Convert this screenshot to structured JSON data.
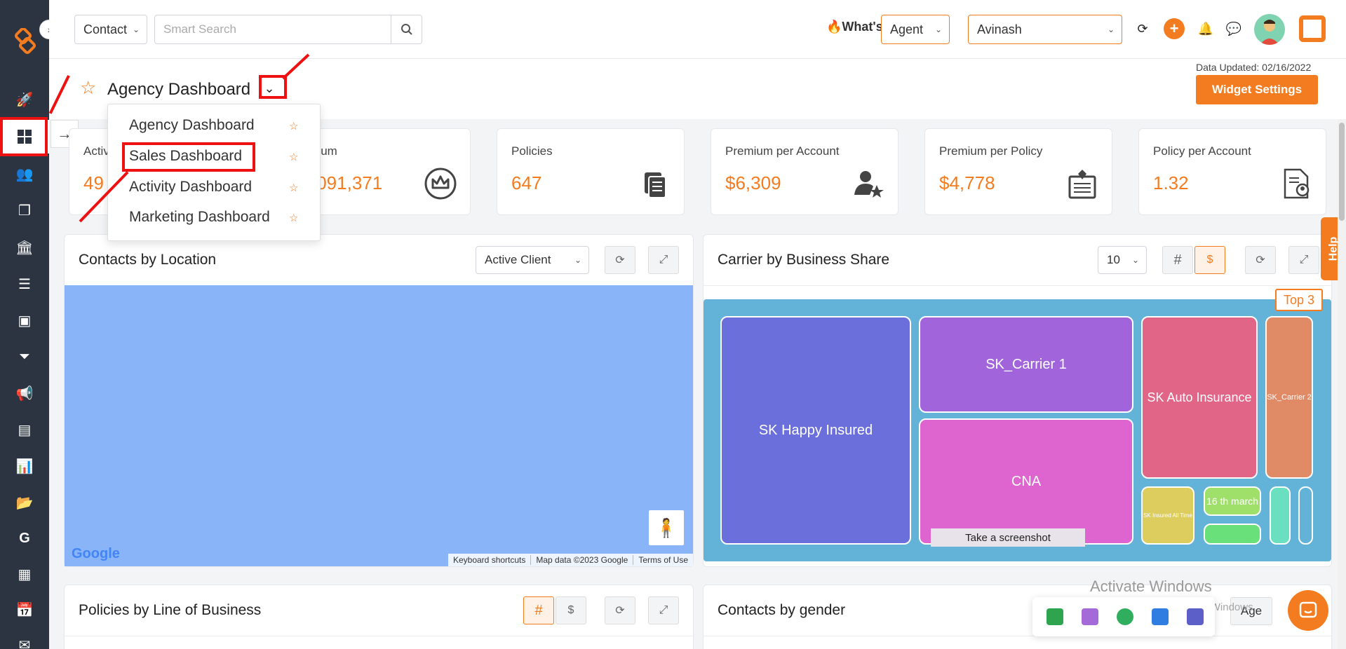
{
  "topbar": {
    "module_select": "Contact",
    "search_placeholder": "Smart Search",
    "whats_new": "What's New",
    "role_select": "Agent",
    "user_select": "Avinash"
  },
  "header": {
    "title": "Agency Dashboard",
    "data_updated": "Data Updated: 02/16/2022",
    "widget_settings": "Widget Settings"
  },
  "dashboard_menu": {
    "items": [
      {
        "label": "Agency Dashboard"
      },
      {
        "label": "Sales Dashboard"
      },
      {
        "label": "Activity Dashboard"
      },
      {
        "label": "Marketing Dashboard"
      }
    ]
  },
  "kpis": [
    {
      "label": "Activ",
      "value": "49"
    },
    {
      "label": "nium",
      "value": ",091,371"
    },
    {
      "label": "Policies",
      "value": "647"
    },
    {
      "label": "Premium per Account",
      "value": "$6,309"
    },
    {
      "label": "Premium per Policy",
      "value": "$4,778"
    },
    {
      "label": "Policy per Account",
      "value": "1.32"
    }
  ],
  "contacts_by_location": {
    "title": "Contacts by Location",
    "filter": "Active Client",
    "google": "Google",
    "credits": [
      "Keyboard shortcuts",
      "Map data ©2023 Google",
      "Terms of Use"
    ]
  },
  "carrier_share": {
    "title": "Carrier by Business Share",
    "count_select": "10",
    "hash_label": "#",
    "dollar_label": "$",
    "top_badge": "Top 3",
    "tiles": [
      {
        "label": "SK Happy Insured",
        "color": "#6b6fdb"
      },
      {
        "label": "SK_Carrier 1",
        "color": "#a264db"
      },
      {
        "label": "SK Auto Insurance",
        "color": "#e06587"
      },
      {
        "label": "SK_Carrier 2",
        "color": "#e08a66"
      },
      {
        "label": "CNA",
        "color": "#de64cf"
      },
      {
        "label": "SK Insured All Time",
        "color": "#dccd5e"
      },
      {
        "label": "16 th march",
        "color": "#9ee06a"
      },
      {
        "label": "",
        "color": "#6ae07a"
      },
      {
        "label": "",
        "color": "#6ae0c0"
      },
      {
        "label": "",
        "color": "#63b3d9"
      }
    ],
    "screenshot_tip": "Take a screenshot"
  },
  "policies_by_lob": {
    "title": "Policies by Line of Business",
    "hash_label": "#",
    "dollar_label": "$"
  },
  "contacts_by_gender": {
    "title": "Contacts by gender",
    "age_label": "Age"
  },
  "help_tab": "Help",
  "windows_watermark": {
    "line1": "Activate Windows",
    "line2": "Go to Settings to activate Windows."
  },
  "colors": {
    "accent": "#f47c20",
    "sidebar": "#2b3440",
    "annotation": "#ee1111"
  }
}
